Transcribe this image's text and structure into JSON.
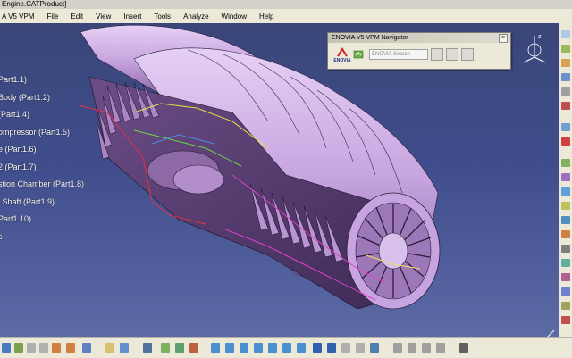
{
  "title_bar": {
    "text": "Engine.CATProduct]"
  },
  "menu": {
    "items": [
      {
        "label": "A V5 VPM"
      },
      {
        "label": "File"
      },
      {
        "label": "Edit"
      },
      {
        "label": "View"
      },
      {
        "label": "Insert"
      },
      {
        "label": "Tools"
      },
      {
        "label": "Analyze"
      },
      {
        "label": "Window"
      },
      {
        "label": "Help"
      }
    ]
  },
  "tree": {
    "items": [
      {
        "label": "Part1.1)"
      },
      {
        "label": "Body (Part1.2)"
      },
      {
        "label": "(Part1.4)"
      },
      {
        "label": "ompressor (Part1.5)"
      },
      {
        "label": "e (Part1.6)"
      },
      {
        "label": "2 (Part1.7)"
      },
      {
        "label": "stion Chamber (Part1.8)"
      },
      {
        "label": "l Shaft (Part1.9)"
      },
      {
        "label": "Part1.10)"
      },
      {
        "label": "s"
      }
    ]
  },
  "navigator": {
    "title": "ENOVIA V5 VPM Navigator",
    "logo_text": "ENOVIA",
    "search_placeholder": "ENOVIA Search"
  },
  "colors": {
    "background": "#3d4a85",
    "engine_body": "#c9a8e0",
    "toolbar": "#ece9d8"
  },
  "icons": {
    "compass": "compass-icon",
    "axis": "xyz-axis-icon"
  }
}
